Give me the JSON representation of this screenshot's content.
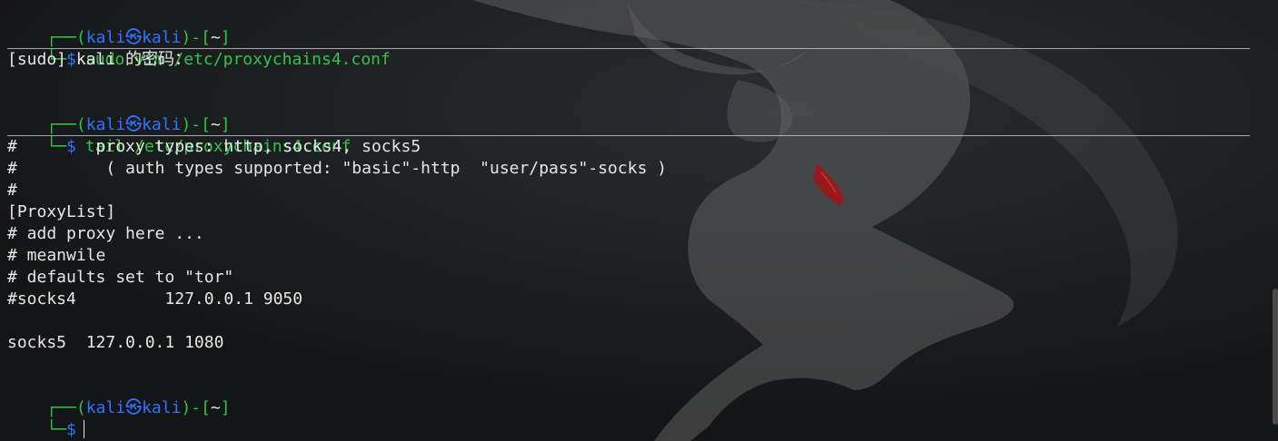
{
  "terminal": {
    "user": "kali",
    "host": "kali",
    "cwd": "~",
    "prompt_char": "$",
    "commands": [
      "sudo vim /etc/proxychains4.conf",
      "tail /etc/proxychains4.conf"
    ],
    "sudo_prompt": "[sudo] kali 的密码：",
    "output_lines": [
      "#        proxy types: http, socks4, socks5",
      "#         ( auth types supported: \"basic\"-http  \"user/pass\"-socks )",
      "#",
      "[ProxyList]",
      "# add proxy here ...",
      "# meanwile",
      "# defaults set to \"tor\"",
      "#socks4         127.0.0.1 9050",
      "",
      "socks5  127.0.0.1 1080"
    ]
  },
  "colors": {
    "background": "#1b1d1f",
    "prompt_frame": "#2fc54b",
    "prompt_user": "#2f72ff",
    "text": "#e6e6e6"
  }
}
